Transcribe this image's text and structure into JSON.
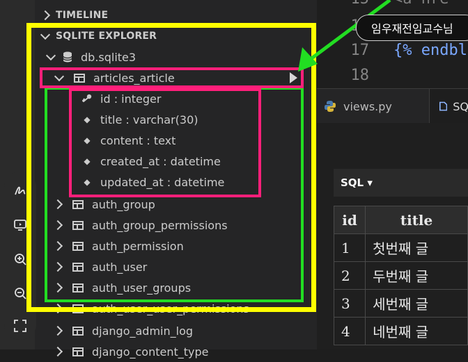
{
  "sidebar": {
    "timeline_label": "TIMELINE",
    "explorer_label": "SQLITE EXPLORER",
    "db_name": "db.sqlite3",
    "expanded_table": "articles_article",
    "columns": [
      {
        "label": "id : integer",
        "icon": "key-icon"
      },
      {
        "label": "title : varchar(30)",
        "icon": "diamond-icon"
      },
      {
        "label": "content : text",
        "icon": "diamond-icon"
      },
      {
        "label": "created_at : datetime",
        "icon": "diamond-icon"
      },
      {
        "label": "updated_at : datetime",
        "icon": "diamond-icon"
      }
    ],
    "tables": [
      "auth_group",
      "auth_group_permissions",
      "auth_permission",
      "auth_user",
      "auth_user_groups",
      "auth_user_user_permissions",
      "django_admin_log",
      "django_content_type"
    ]
  },
  "editor": {
    "lines": [
      {
        "no": "15",
        "code": "<a hre"
      },
      {
        "no": "16",
        "code": ""
      },
      {
        "no": "17",
        "code": "{% endbl"
      },
      {
        "no": "18",
        "code": ""
      }
    ],
    "tabs": [
      "views.py",
      "SQ"
    ]
  },
  "sql_panel": {
    "toolbar_label": "SQL ▾",
    "headers": [
      "id",
      "title"
    ],
    "rows": [
      [
        "1",
        "첫번째 글"
      ],
      [
        "2",
        "두번째 글"
      ],
      [
        "3",
        "세번째 글"
      ],
      [
        "4",
        "네번째 글"
      ]
    ]
  },
  "annotation": {
    "bubble_text": "임우재전임교수님"
  },
  "colors": {
    "yellow_highlight": "#ffff00",
    "green_highlight": "#22dd22",
    "pink_highlight": "#ff1f7a"
  }
}
